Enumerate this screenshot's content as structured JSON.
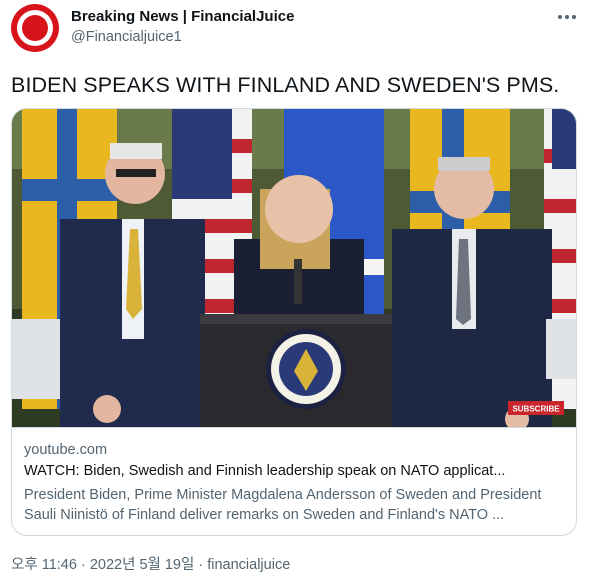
{
  "author": {
    "display_name": "Breaking News | FinancialJuice",
    "handle": "@Financialjuice1"
  },
  "tweet": {
    "text": "BIDEN SPEAKS WITH FINLAND AND SWEDEN'S PMS."
  },
  "card": {
    "domain": "youtube.com",
    "title": "WATCH: Biden, Swedish and Finnish leadership speak on NATO applicat...",
    "description": "President Biden, Prime Minister Magdalena Andersson of Sweden and President Sauli Niinistö of Finland deliver remarks on Sweden and Finland's NATO ...",
    "media": {
      "overlay_label": "SUBSCRIBE"
    }
  },
  "meta": {
    "time": "오후 11:46",
    "separator": " · ",
    "date": "2022년 5월 19일",
    "separator2": " · ",
    "source": "financialjuice"
  },
  "colors": {
    "brand_red": "#d7141a",
    "muted": "#536471",
    "border": "#cfd9de"
  },
  "icons": {
    "more": "more-horizontal-icon",
    "avatar": "financialjuice-logo"
  }
}
